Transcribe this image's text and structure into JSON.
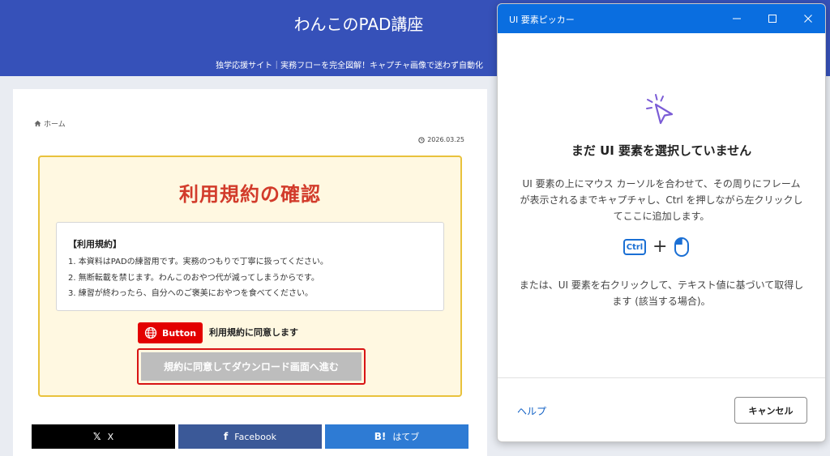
{
  "site": {
    "title": "わんこのPAD講座",
    "tagline": "独学応援サイト｜実務フローを完全図解！キャプチャ画像で迷わず自動化",
    "breadcrumb_home": "ホーム",
    "post_date": "2026.03.25"
  },
  "terms": {
    "title": "利用規約の確認",
    "heading": "【利用規約】",
    "lines": [
      "1. 本資料はPADの練習用です。実務のつもりで丁寧に扱ってください。",
      "2. 無断転載を禁じます。わんこのおやつ代が減ってしまうからです。",
      "3. 練習が終わったら、自分へのご褒美におやつを食べてください。"
    ],
    "button_tag_label": "Button",
    "agree_label": "利用規約に同意します",
    "download_button": "規約に同意してダウンロード画面へ進む"
  },
  "share": {
    "x_label": "X",
    "x_icon": "𝕏",
    "facebook_label": "Facebook",
    "facebook_icon": "f",
    "hatena_label": "はてブ",
    "hatena_icon": "B!"
  },
  "picker": {
    "title": "UI 要素ピッカー",
    "heading": "まだ UI 要素を選択していません",
    "description": "UI 要素の上にマウス カーソルを合わせて、その周りにフレームが表示されるまでキャプチャし、Ctrl を押しながら左クリックしてここに追加します。",
    "ctrl_key": "Ctrl",
    "plus": "+",
    "alternative": "または、UI 要素を右クリックして、テキスト値に基づいて取得します (該当する場合)。",
    "help_link": "ヘルプ",
    "cancel_button": "キャンセル"
  },
  "colors": {
    "header_blue": "#3651b9",
    "picker_titlebar": "#0a6ee0",
    "terms_title_red": "#d23b2b",
    "button_tag_red": "#e30000",
    "accent_purple": "#7b5cd6"
  }
}
